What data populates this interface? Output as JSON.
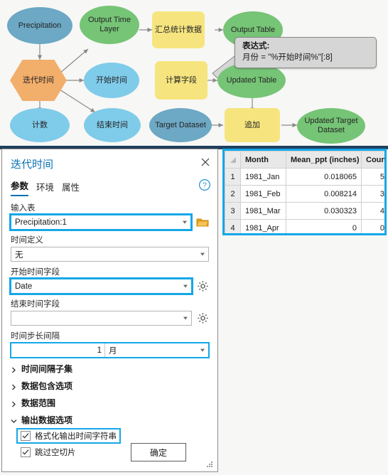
{
  "diagram": {
    "nodes": [
      {
        "id": "precipitation",
        "label": "Precipitation",
        "type": "oval",
        "color": "#6da8c4"
      },
      {
        "id": "output-time-layer",
        "label": "Output Time Layer",
        "type": "oval",
        "color": "#76c476"
      },
      {
        "id": "summary-statistics",
        "label": "汇总统计数据",
        "type": "rect",
        "color": "#f6e57f"
      },
      {
        "id": "output-table",
        "label": "Output Table",
        "type": "oval",
        "color": "#76c476"
      },
      {
        "id": "iterate-time",
        "label": "迭代时间",
        "type": "hexagon",
        "color": "#f2ae6b"
      },
      {
        "id": "start-time",
        "label": "开始时间",
        "type": "oval",
        "color": "#7fcbea"
      },
      {
        "id": "calculate-field",
        "label": "计算字段",
        "type": "rect",
        "color": "#f6e57f"
      },
      {
        "id": "updated-table",
        "label": "Updated Table",
        "type": "oval",
        "color": "#76c476"
      },
      {
        "id": "count",
        "label": "计数",
        "type": "oval",
        "color": "#7fcbea"
      },
      {
        "id": "end-time",
        "label": "结束时间",
        "type": "oval",
        "color": "#7fcbea"
      },
      {
        "id": "target-dataset",
        "label": "Target Dataset",
        "type": "oval",
        "color": "#6da8c4"
      },
      {
        "id": "append",
        "label": "追加",
        "type": "rect",
        "color": "#f6e57f"
      },
      {
        "id": "updated-target-dataset",
        "label": "Updated Target Dataset",
        "type": "oval",
        "color": "#76c476"
      }
    ],
    "callout": {
      "title": "表达式:",
      "expression": "月份 = \"%开始时间%\"[:8]"
    }
  },
  "gp_dialog": {
    "title": "迭代时间",
    "close_icon": "close-icon",
    "help_icon": "help-icon",
    "tabs": [
      {
        "label": "参数",
        "active": true
      },
      {
        "label": "环境",
        "active": false
      },
      {
        "label": "属性",
        "active": false
      }
    ],
    "fields": {
      "input_table": {
        "label": "输入表",
        "value": "Precipitation:1",
        "highlighted": true,
        "browse_icon": "folder-icon"
      },
      "time_definition": {
        "label": "时间定义",
        "value": "无",
        "highlighted": false
      },
      "start_time_field": {
        "label": "开始时间字段",
        "value": "Date",
        "highlighted": true,
        "settings_icon": "gear-icon"
      },
      "end_time_field": {
        "label": "结束时间字段",
        "value": "",
        "highlighted": false,
        "settings_icon": "gear-icon"
      },
      "time_step_interval": {
        "label": "时间步长间隔",
        "value": "1",
        "unit": "月",
        "highlighted": true
      }
    },
    "sections": [
      {
        "label": "时间间隔子集",
        "expanded": false
      },
      {
        "label": "数据包含选项",
        "expanded": false
      },
      {
        "label": "数据范围",
        "expanded": false
      },
      {
        "label": "输出数据选项",
        "expanded": true
      }
    ],
    "checkboxes": [
      {
        "label": "格式化输出时间字符串",
        "checked": true,
        "highlighted": true
      },
      {
        "label": "跳过空切片",
        "checked": true,
        "highlighted": false
      }
    ],
    "ok_button": "确定"
  },
  "attribute_table": {
    "columns": [
      "",
      "Month",
      "Mean_ppt (inches)",
      "Count"
    ],
    "rows": [
      {
        "idx": "1",
        "month": "1981_Jan",
        "mean_ppt": "0.018065",
        "count": "5"
      },
      {
        "idx": "2",
        "month": "1981_Feb",
        "mean_ppt": "0.008214",
        "count": "3"
      },
      {
        "idx": "3",
        "month": "1981_Mar",
        "mean_ppt": "0.030323",
        "count": "4"
      },
      {
        "idx": "4",
        "month": "1981_Apr",
        "mean_ppt": "0",
        "count": "0"
      }
    ]
  },
  "colors": {
    "highlight": "#14a7e8",
    "accent": "#0a70b4",
    "band": "#1f3f5e"
  }
}
